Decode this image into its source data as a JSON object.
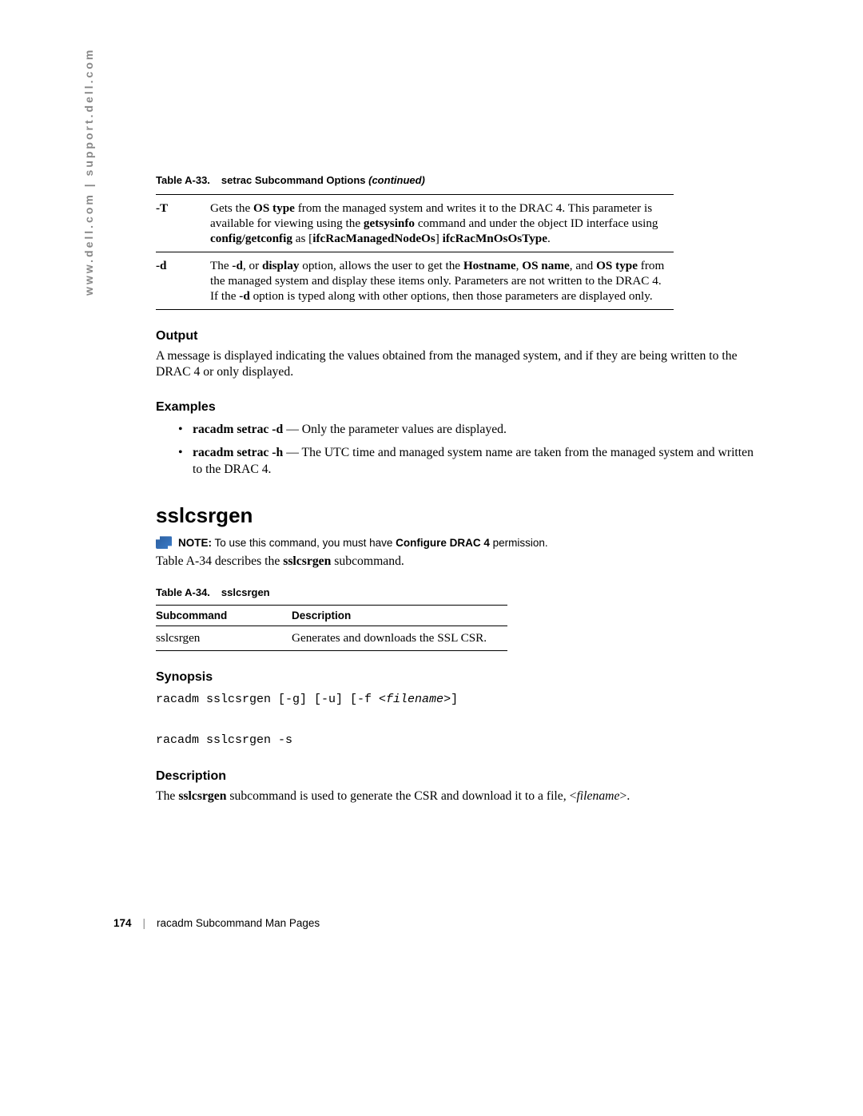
{
  "side_text": "www.dell.com | support.dell.com",
  "table33": {
    "caption_prefix": "Table A-33.",
    "caption_title": "setrac Subcommand Options ",
    "caption_suffix": "(continued)",
    "rows": [
      {
        "flag": "-T",
        "parts": [
          {
            "t": "Gets the "
          },
          {
            "t": "OS type",
            "b": true
          },
          {
            "t": " from the managed system and writes it to the DRAC 4. This parameter is available for viewing using the "
          },
          {
            "t": "getsysinfo",
            "b": true
          },
          {
            "t": " command and under the object ID interface using "
          },
          {
            "t": "config/getconfig",
            "b": true
          },
          {
            "t": " as ["
          },
          {
            "t": "ifcRacManagedNodeOs",
            "b": true
          },
          {
            "t": "] "
          },
          {
            "t": "ifcRacMnOsOsType",
            "b": true
          },
          {
            "t": "."
          }
        ]
      },
      {
        "flag": "-d",
        "parts": [
          {
            "t": "The "
          },
          {
            "t": "-d",
            "b": true
          },
          {
            "t": ", or "
          },
          {
            "t": "display",
            "b": true
          },
          {
            "t": " option, allows the user to get the "
          },
          {
            "t": "Hostname",
            "b": true
          },
          {
            "t": ", "
          },
          {
            "t": "OS name",
            "b": true
          },
          {
            "t": ", and "
          },
          {
            "t": "OS type",
            "b": true
          },
          {
            "t": " from the managed system and display these items only. Parameters are not written to the DRAC 4. If the "
          },
          {
            "t": "-d",
            "b": true
          },
          {
            "t": " option is typed along with other options, then those parameters are displayed only."
          }
        ]
      }
    ]
  },
  "output": {
    "heading": "Output",
    "text": "A message is displayed indicating the values obtained from the managed system, and if they are being written to the DRAC 4 or only displayed."
  },
  "examples": {
    "heading": "Examples",
    "items": [
      {
        "cmd": "racadm setrac -d",
        "desc": " — Only the parameter values are displayed."
      },
      {
        "cmd": "racadm setrac -h",
        "desc": " — The UTC time and managed system name are taken from the managed system and written to the DRAC 4."
      }
    ]
  },
  "sslcsrgen": {
    "heading": "sslcsrgen",
    "note_label": "NOTE:",
    "note_pre": " To use this command, you must have ",
    "note_perm": "Configure DRAC 4",
    "note_post": " permission.",
    "desc_line_pre": "Table A-34 describes the ",
    "desc_line_cmd": "sslcsrgen",
    "desc_line_post": " subcommand.",
    "table": {
      "caption_prefix": "Table A-34.",
      "caption_title": "sslcsrgen",
      "h1": "Subcommand",
      "h2": "Description",
      "c1": "sslcsrgen",
      "c2": "Generates and downloads the SSL CSR."
    },
    "synopsis": {
      "heading": "Synopsis",
      "line1_a": "racadm sslcsrgen [-g] [-u] [-f <",
      "line1_b": "filename",
      "line1_c": ">]",
      "line2": "racadm sslcsrgen -s"
    },
    "description": {
      "heading": "Description",
      "pre": "The ",
      "cmd": "sslcsrgen",
      "mid": " subcommand is used to generate the CSR and download it to a file, <",
      "fn": "filename",
      "post": ">."
    }
  },
  "footer": {
    "page": "174",
    "sep": "|",
    "title": "racadm Subcommand Man Pages"
  }
}
